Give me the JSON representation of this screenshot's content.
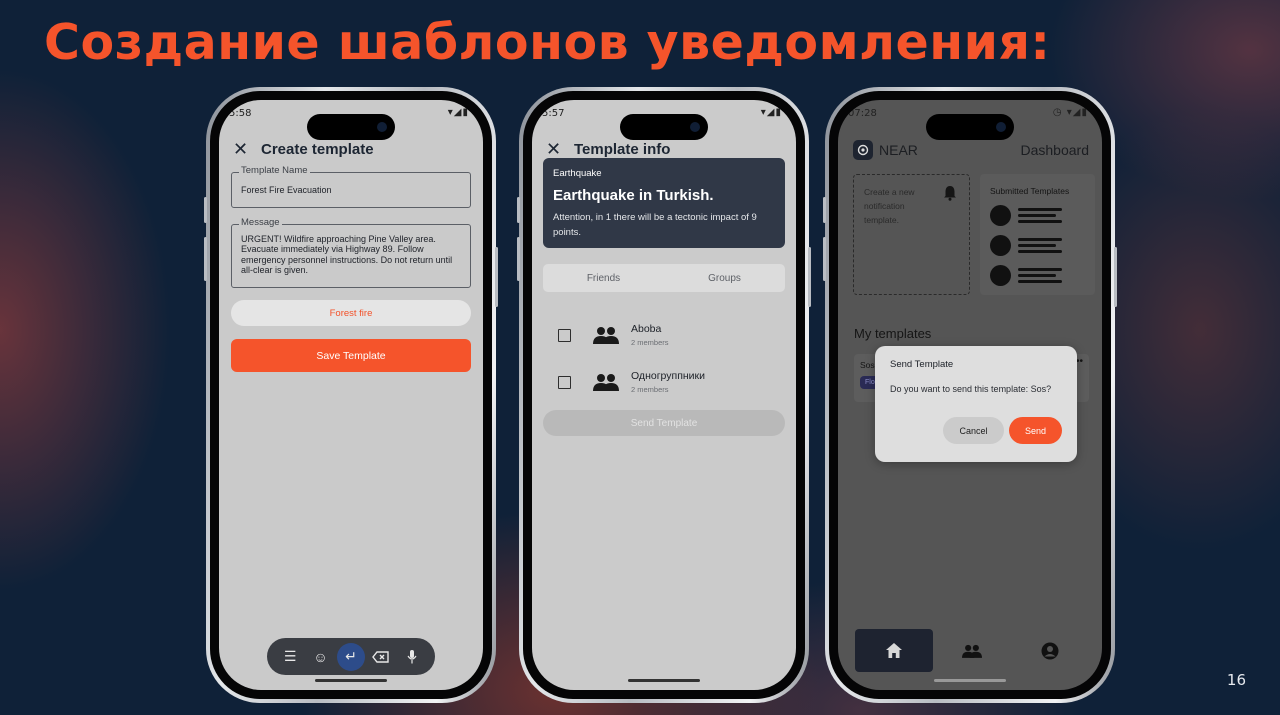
{
  "slide": {
    "title": "Создание шаблонов уведомления:",
    "page_number": "16"
  },
  "phone1": {
    "status_time": "5:58",
    "title": "Create template",
    "template_name_label": "Template Name",
    "template_name_value": "Forest Fire Evacuation",
    "message_label": "Message",
    "message_value": "URGENT! Wildfire approaching Pine Valley area. Evacuate immediately via Highway 89. Follow emergency personnel instructions. Do not return until all-clear is given.",
    "category_chip": "Forest fire",
    "save_button": "Save Template",
    "keyboard_icons": [
      "menu-icon",
      "emoji-icon",
      "enter-icon",
      "backspace-icon",
      "mic-icon"
    ]
  },
  "phone2": {
    "status_time": "5:57",
    "title": "Template info",
    "card": {
      "category": "Earthquake",
      "heading": "Earthquake in Turkish.",
      "description": "Attention, in 1 there will be a tectonic impact of 9 points."
    },
    "tabs": [
      "Friends",
      "Groups"
    ],
    "groups": [
      {
        "name": "Aboba",
        "members": "2 members"
      },
      {
        "name": "Одногруппники",
        "members": "2 members"
      }
    ],
    "send_button": "Send Template"
  },
  "phone3": {
    "status_time": "07:28",
    "brand": "NEAR",
    "header_title": "Dashboard",
    "create_card_text": "Create a new notification template.",
    "submitted_title": "Submitted Templates",
    "my_templates_title": "My templates",
    "template_item": {
      "name": "Sos",
      "tag": "Flo"
    },
    "dialog": {
      "title": "Send Template",
      "message": "Do you want to send this template: Sos?",
      "cancel": "Cancel",
      "send": "Send"
    },
    "nav_icons": [
      "home-icon",
      "people-icon",
      "profile-icon"
    ]
  },
  "colors": {
    "accent": "#f5542b",
    "background": "#0f2138",
    "dark_card": "#303847"
  }
}
